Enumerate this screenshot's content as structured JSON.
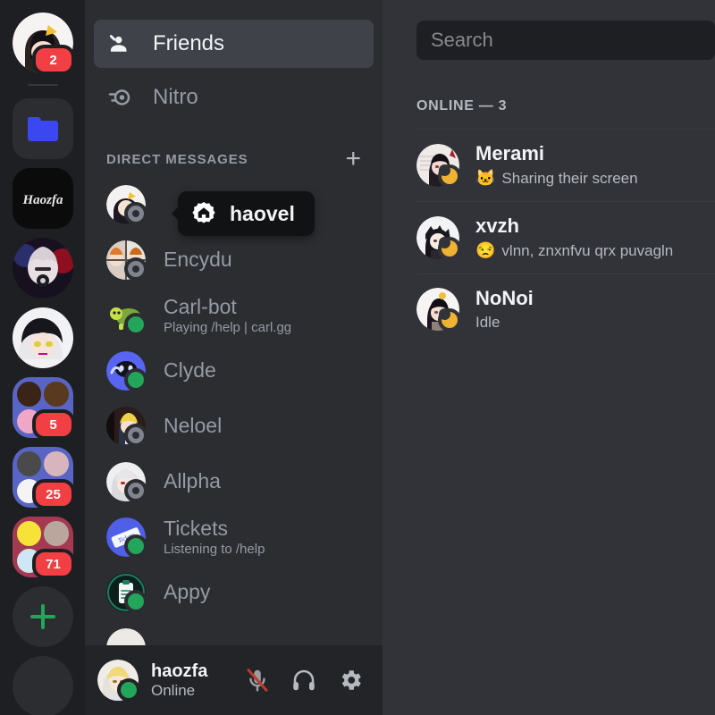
{
  "colors": {
    "rail_bg": "#1e1f22",
    "sidebar_bg": "#2b2d31",
    "main_bg": "#313338",
    "userbar_bg": "#232428",
    "active_row": "#3f4248",
    "badge_red": "#f23f43",
    "online_green": "#23a55a",
    "idle_yellow": "#f0b232",
    "accent_blurple": "#5865f2",
    "text_primary": "#f2f3f5",
    "text_muted": "#949ba4"
  },
  "server_rail": {
    "items": [
      {
        "name": "home-avatar",
        "icon": "user-avatar",
        "badge": "2",
        "shape": "circle"
      },
      {
        "name": "server-folder",
        "icon": "folder-icon",
        "badge": "",
        "shape": "rounded"
      },
      {
        "name": "server-haozfa",
        "icon": "server-haozfa-icon",
        "badge": "",
        "shape": "rounded"
      },
      {
        "name": "server-anime-1",
        "icon": "server-avatar",
        "badge": "",
        "shape": "circle"
      },
      {
        "name": "server-anime-2",
        "icon": "server-avatar",
        "badge": "",
        "shape": "circle"
      },
      {
        "name": "group-dm-1",
        "icon": "group-avatar",
        "badge": "5",
        "shape": "rounded"
      },
      {
        "name": "group-dm-2",
        "icon": "group-avatar",
        "badge": "25",
        "shape": "rounded"
      },
      {
        "name": "group-dm-3",
        "icon": "group-avatar",
        "badge": "71",
        "shape": "rounded"
      },
      {
        "name": "add-server",
        "icon": "plus-icon",
        "badge": "",
        "shape": "circle"
      }
    ]
  },
  "sidebar": {
    "nav": [
      {
        "label": "Friends",
        "icon": "friends-icon",
        "active": true
      },
      {
        "label": "Nitro",
        "icon": "nitro-icon",
        "active": false
      }
    ],
    "dm_section": {
      "label": "DIRECT MESSAGES",
      "add_button": "+"
    },
    "tooltip": {
      "label": "haovel",
      "icon": "server-boost-badge-icon"
    },
    "dms": [
      {
        "name": "",
        "sub": "",
        "status": "offline",
        "hidden": true
      },
      {
        "name": "Encydu",
        "sub": "",
        "status": "offline"
      },
      {
        "name": "Carl-bot",
        "sub": "Playing /help | carl.gg",
        "status": "online"
      },
      {
        "name": "Clyde",
        "sub": "",
        "status": "online"
      },
      {
        "name": "Neloel",
        "sub": "",
        "status": "offline"
      },
      {
        "name": "Allpha",
        "sub": "",
        "status": "offline"
      },
      {
        "name": "Tickets",
        "sub": "Listening to /help",
        "status": "online"
      },
      {
        "name": "Appy",
        "sub": "",
        "status": "online"
      }
    ],
    "user_panel": {
      "username": "haozfa",
      "status": "Online",
      "status_type": "online",
      "buttons": [
        {
          "label": "Mute",
          "icon": "microphone-muted-icon",
          "muted": true
        },
        {
          "label": "Deafen",
          "icon": "headphones-icon",
          "muted": false
        },
        {
          "label": "User Settings",
          "icon": "gear-icon",
          "muted": false
        }
      ]
    }
  },
  "main": {
    "search": {
      "placeholder": "Search",
      "value": ""
    },
    "online_header": "ONLINE — 3",
    "members": [
      {
        "name": "Merami",
        "sub": "Sharing their screen",
        "emoji": "🐱",
        "status": "idle"
      },
      {
        "name": "xvzh",
        "sub": "vlnn, znxnfvu qrx puvagln",
        "emoji": "😒",
        "status": "idle"
      },
      {
        "name": "NoNoi",
        "sub": "Idle",
        "emoji": "",
        "status": "idle"
      }
    ]
  }
}
